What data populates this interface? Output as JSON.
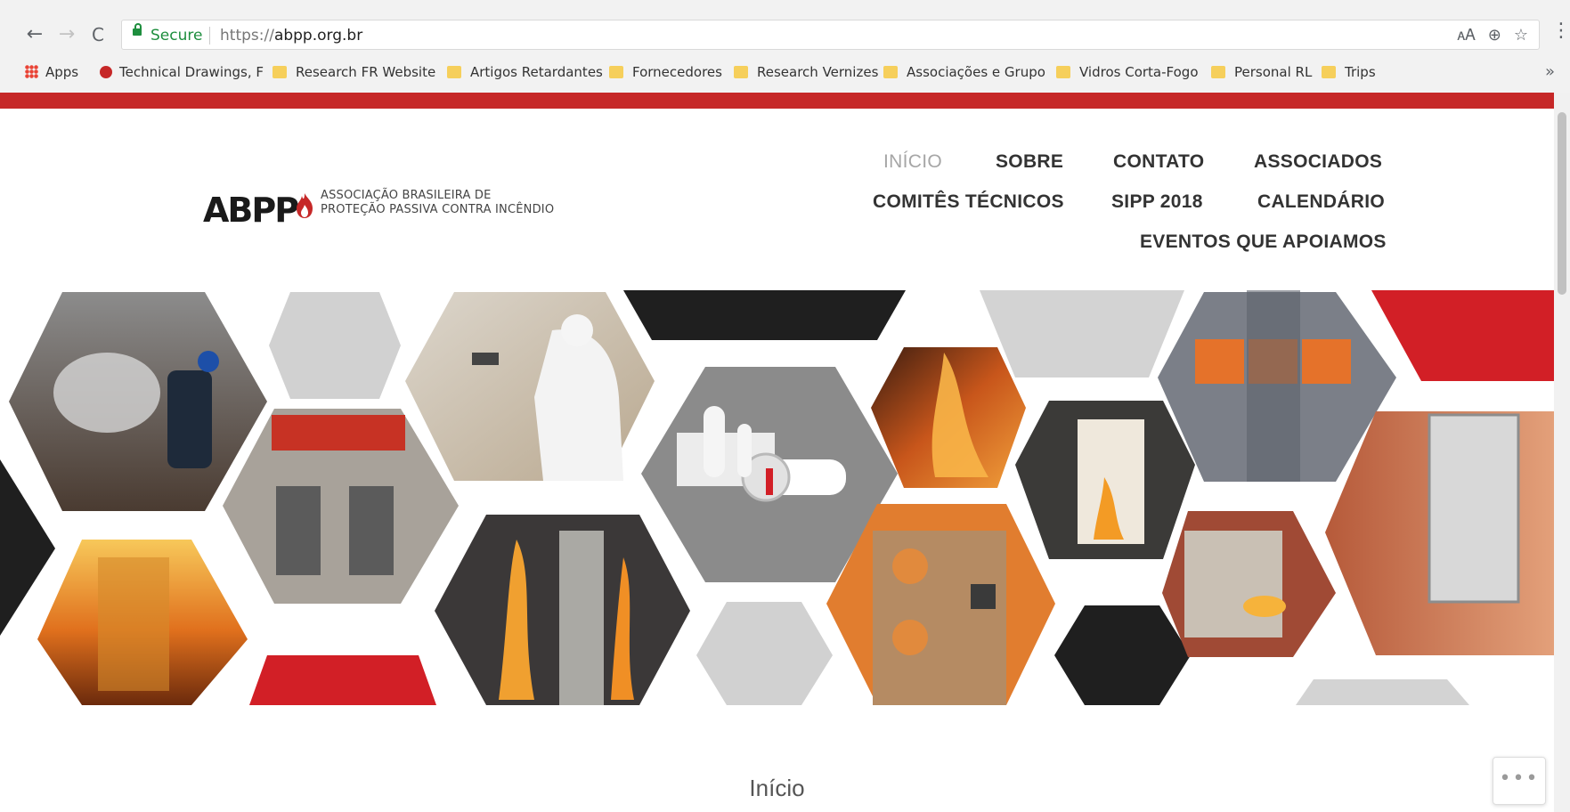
{
  "browser": {
    "back": "←",
    "forward": "→",
    "reload": "C",
    "secure_label": "Secure",
    "url_protocol": "https://",
    "url_host": "abpp.org.br",
    "omni_icons": [
      "translate-icon",
      "zoom-icon",
      "star-icon"
    ],
    "menu": "⋮",
    "bookmarks_more": "»",
    "bookmarks": [
      {
        "label": "Apps",
        "icon": "apps-grid-icon"
      },
      {
        "label": "Technical Drawings, F",
        "icon": "site-favicon"
      },
      {
        "label": "Research FR Website",
        "icon": "folder-icon"
      },
      {
        "label": "Artigos Retardantes",
        "icon": "folder-icon"
      },
      {
        "label": "Fornecedores",
        "icon": "folder-icon"
      },
      {
        "label": "Research Vernizes",
        "icon": "folder-icon"
      },
      {
        "label": "Associações e Grupo",
        "icon": "folder-icon"
      },
      {
        "label": "Vidros Corta-Fogo",
        "icon": "folder-icon"
      },
      {
        "label": "Personal RL",
        "icon": "folder-icon"
      },
      {
        "label": "Trips",
        "icon": "folder-icon"
      }
    ]
  },
  "site": {
    "brand_color": "#c62828",
    "logo": {
      "mark": "ABPP",
      "line1": "ASSOCIAÇÃO BRASILEIRA DE",
      "line2": "PROTEÇÃO PASSIVA CONTRA INCÊNDIO"
    },
    "nav": {
      "inicio": "INÍCIO",
      "sobre": "SOBRE",
      "contato": "CONTATO",
      "associados": "ASSOCIADOS",
      "comites": "COMITÊS TÉCNICOS",
      "sipp": "SIPP 2018",
      "calendario": "CALENDÁRIO",
      "eventos": "EVENTOS QUE APOIAMOS"
    },
    "page_title": "Início",
    "floating_button": "•••"
  }
}
